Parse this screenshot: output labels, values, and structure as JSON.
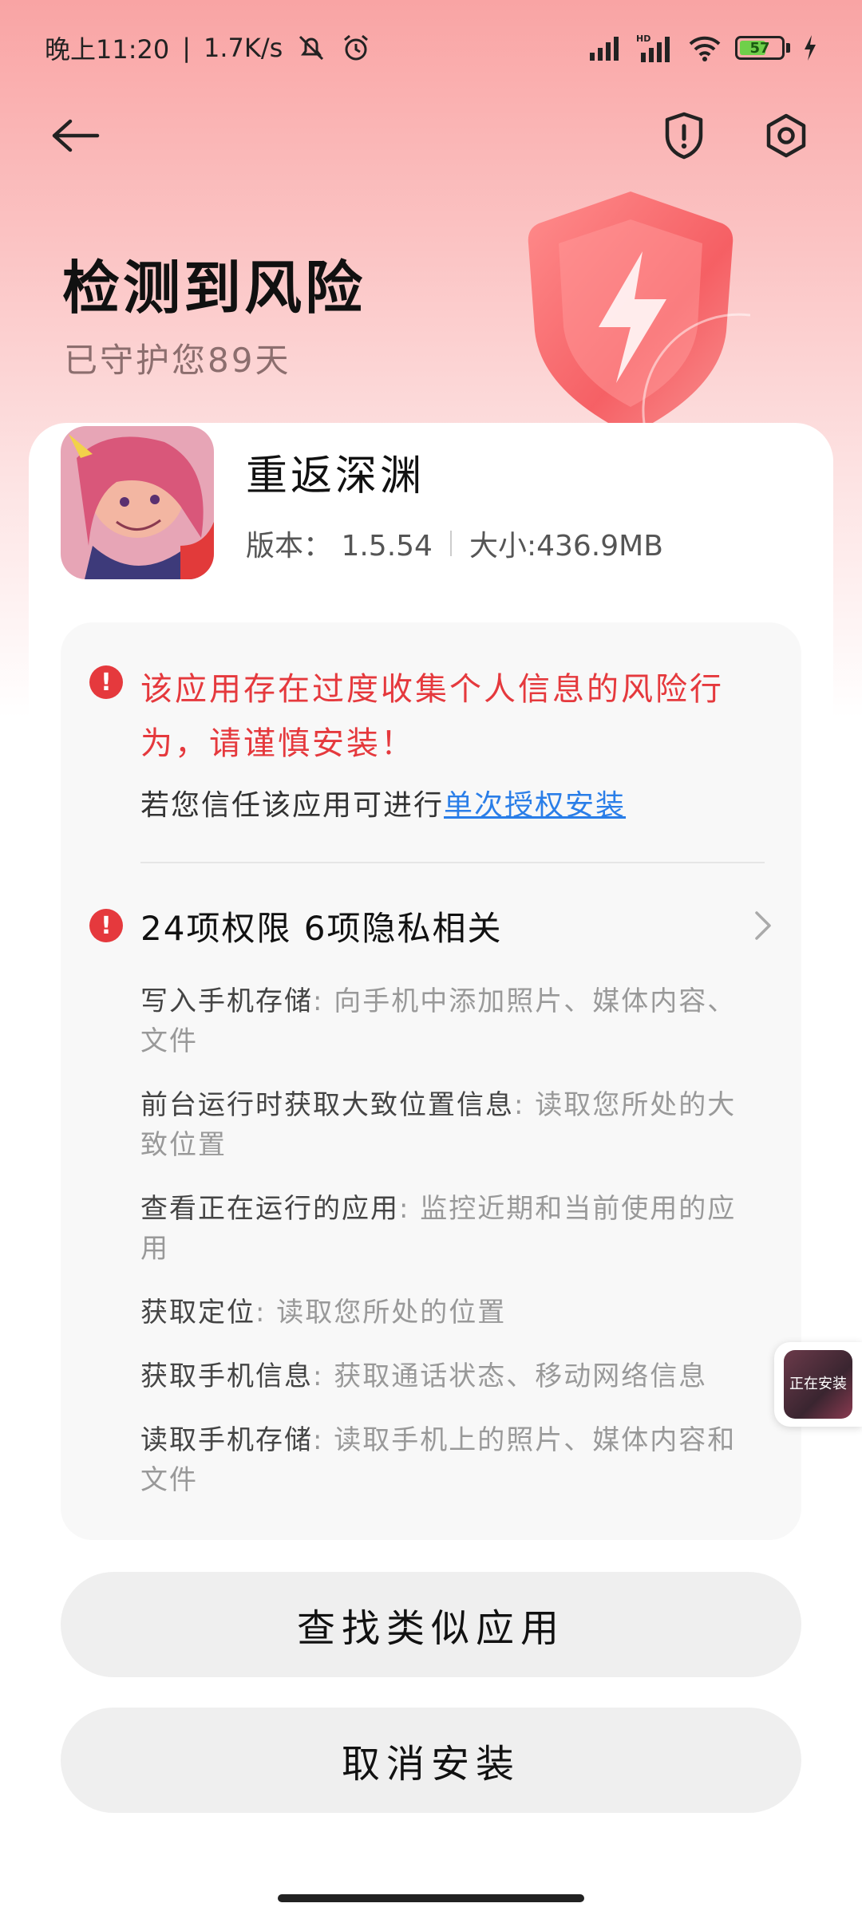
{
  "status_bar": {
    "time": "晚上11:20",
    "speed": "1.7K/s",
    "battery": "57"
  },
  "header": {
    "title": "检测到风险",
    "subtitle": "已守护您89天"
  },
  "app": {
    "name": "重返深渊",
    "version": "版本： 1.5.54",
    "size": "大小:436.9MB"
  },
  "risk": {
    "warning": "该应用存在过度收集个人信息的风险行为，请谨慎安装！",
    "trust_prefix": "若您信任该应用可进行",
    "trust_link": "单次授权安装",
    "permissions_title": "24项权限 6项隐私相关",
    "permissions": [
      {
        "name": "写入手机存储",
        "desc": "向手机中添加照片、媒体内容、文件"
      },
      {
        "name": "前台运行时获取大致位置信息",
        "desc": "读取您所处的大致位置"
      },
      {
        "name": "查看正在运行的应用",
        "desc": "监控近期和当前使用的应用"
      },
      {
        "name": "获取定位",
        "desc": "读取您所处的位置"
      },
      {
        "name": "获取手机信息",
        "desc": "获取通话状态、移动网络信息"
      },
      {
        "name": "读取手机存储",
        "desc": "读取手机上的照片、媒体内容和文件"
      }
    ]
  },
  "actions": {
    "find_similar": "查找类似应用",
    "cancel_install": "取消安装"
  },
  "floating": {
    "label": "正在安装"
  },
  "colors": {
    "danger": "#e5393d",
    "link": "#2a7ee8"
  }
}
